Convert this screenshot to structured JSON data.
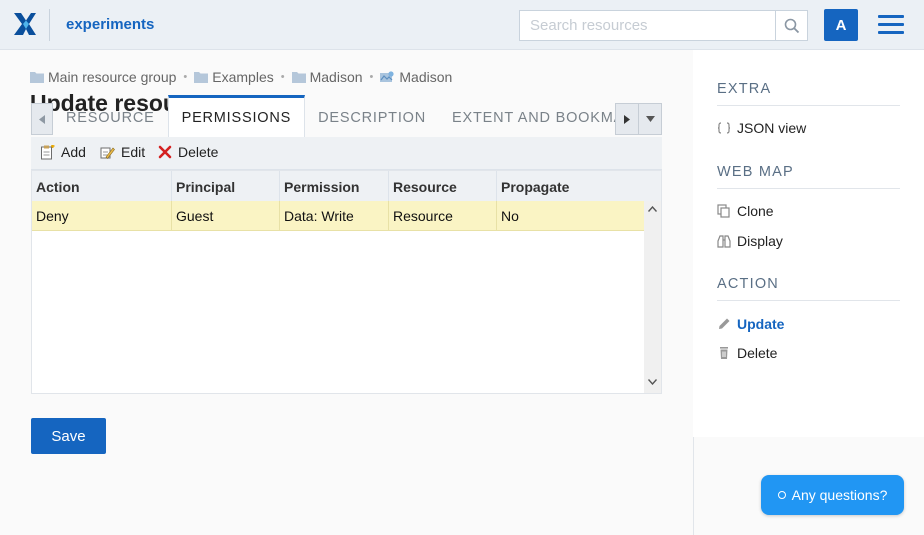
{
  "header": {
    "app_name": "experiments",
    "search_placeholder": "Search resources",
    "avatar_letter": "A"
  },
  "breadcrumb": [
    {
      "label": "Main resource group",
      "icon": "folder-icon"
    },
    {
      "label": "Examples",
      "icon": "folder-icon"
    },
    {
      "label": "Madison",
      "icon": "folder-icon"
    },
    {
      "label": "Madison",
      "icon": "webmap-icon"
    }
  ],
  "page_title": "Update resource",
  "tabs": [
    {
      "label": "RESOURCE",
      "active": false
    },
    {
      "label": "PERMISSIONS",
      "active": true
    },
    {
      "label": "DESCRIPTION",
      "active": false
    },
    {
      "label": "EXTENT AND BOOKMARK",
      "active": false
    }
  ],
  "toolbar": {
    "add_label": "Add",
    "edit_label": "Edit",
    "delete_label": "Delete"
  },
  "grid": {
    "columns": [
      "Action",
      "Principal",
      "Permission",
      "Resource",
      "Propagate"
    ],
    "rows": [
      [
        "Deny",
        "Guest",
        "Data: Write",
        "Resource",
        "No"
      ]
    ]
  },
  "save_label": "Save",
  "sidebar": {
    "sections": [
      {
        "title": "EXTRA",
        "items": [
          {
            "label": "JSON view",
            "icon": "braces-icon"
          }
        ]
      },
      {
        "title": "WEB MAP",
        "items": [
          {
            "label": "Clone",
            "icon": "copy-icon"
          },
          {
            "label": "Display",
            "icon": "binoculars-icon"
          }
        ]
      },
      {
        "title": "ACTION",
        "items": [
          {
            "label": "Update",
            "icon": "pencil-icon",
            "active": true
          },
          {
            "label": "Delete",
            "icon": "trash-icon"
          }
        ]
      }
    ]
  },
  "chat_label": "Any questions?",
  "colors": {
    "accent": "#1565c0",
    "selected_row": "#faf4c4",
    "chat": "#2196f3"
  }
}
